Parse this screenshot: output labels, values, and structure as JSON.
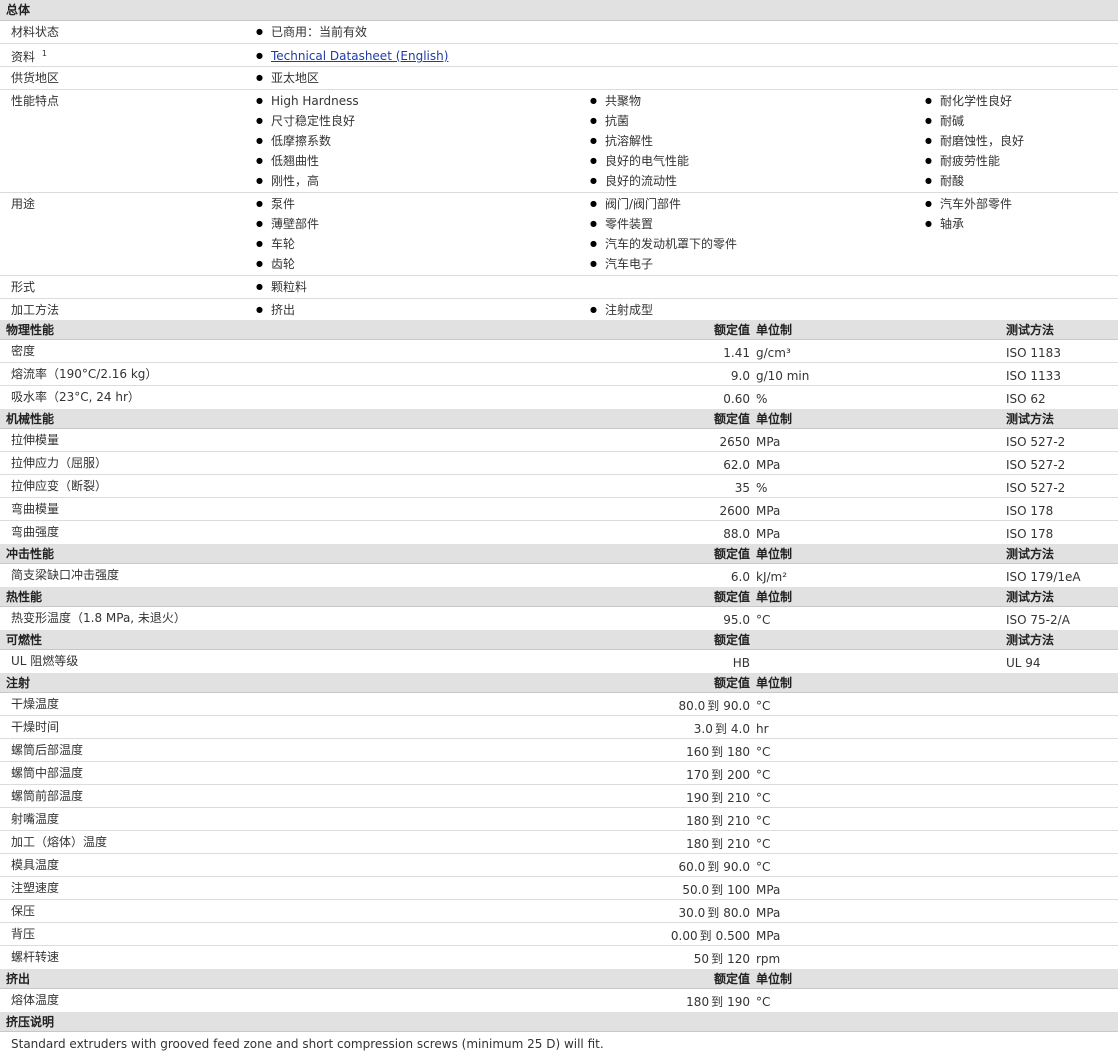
{
  "general": {
    "title": "总体",
    "status_label": "材料状态",
    "status_value": "已商用：当前有效",
    "docs_label": "资料",
    "docs_sup": "1",
    "docs_link": "Technical Datasheet (English)",
    "region_label": "供货地区",
    "region_value": "亚太地区",
    "features_label": "性能特点",
    "features": [
      [
        "High Hardness",
        "尺寸稳定性良好",
        "低摩擦系数",
        "低翘曲性",
        "刚性，高"
      ],
      [
        "共聚物",
        "抗菌",
        "抗溶解性",
        "良好的电气性能",
        "良好的流动性"
      ],
      [
        "耐化学性良好",
        "耐碱",
        "耐磨蚀性，良好",
        "耐疲劳性能",
        "耐酸"
      ]
    ],
    "uses_label": "用途",
    "uses": [
      [
        "泵件",
        "薄壁部件",
        "车轮",
        "齿轮"
      ],
      [
        "阀门/阀门部件",
        "零件装置",
        "汽车的发动机罩下的零件",
        "汽车电子"
      ],
      [
        "汽车外部零件",
        "轴承"
      ]
    ],
    "form_label": "形式",
    "form_value": "颗粒料",
    "process_label": "加工方法",
    "process_values": [
      "挤出",
      "注射成型"
    ]
  },
  "col_headers": {
    "nominal": "额定值",
    "unit": "单位制",
    "method": "测试方法"
  },
  "physical": {
    "title": "物理性能",
    "rows": [
      {
        "name": "密度",
        "value": "1.41",
        "unit": "g/cm³",
        "method": "ISO 1183"
      },
      {
        "name": "熔流率（190°C/2.16 kg）",
        "value": "9.0",
        "unit": "g/10 min",
        "method": "ISO 1133"
      },
      {
        "name": "吸水率（23°C, 24 hr）",
        "value": "0.60",
        "unit": "%",
        "method": "ISO 62"
      }
    ]
  },
  "mechanical": {
    "title": "机械性能",
    "rows": [
      {
        "name": "拉伸模量",
        "value": "2650",
        "unit": "MPa",
        "method": "ISO 527-2"
      },
      {
        "name": "拉伸应力（屈服）",
        "value": "62.0",
        "unit": "MPa",
        "method": "ISO 527-2"
      },
      {
        "name": "拉伸应变（断裂）",
        "value": "35",
        "unit": "%",
        "method": "ISO 527-2"
      },
      {
        "name": "弯曲模量",
        "value": "2600",
        "unit": "MPa",
        "method": "ISO 178"
      },
      {
        "name": "弯曲强度",
        "value": "88.0",
        "unit": "MPa",
        "method": "ISO 178"
      }
    ]
  },
  "impact": {
    "title": "冲击性能",
    "rows": [
      {
        "name": "简支梁缺口冲击强度",
        "value": "6.0",
        "unit": "kJ/m²",
        "method": "ISO 179/1eA"
      }
    ]
  },
  "thermal": {
    "title": "热性能",
    "rows": [
      {
        "name": "热变形温度（1.8 MPa, 未退火）",
        "value": "95.0",
        "unit": "°C",
        "method": "ISO 75-2/A"
      }
    ]
  },
  "flammability": {
    "title": "可燃性",
    "rows": [
      {
        "name": "UL 阻燃等级",
        "value": "HB",
        "unit": "",
        "method": "UL 94"
      }
    ]
  },
  "injection": {
    "title": "注射",
    "range_word": "到",
    "rows": [
      {
        "name": "干燥温度",
        "low": "80.0",
        "high": "90.0",
        "unit": "°C"
      },
      {
        "name": "干燥时间",
        "low": "3.0",
        "high": "4.0",
        "unit": "hr"
      },
      {
        "name": "螺筒后部温度",
        "low": "160",
        "high": "180",
        "unit": "°C"
      },
      {
        "name": "螺筒中部温度",
        "low": "170",
        "high": "200",
        "unit": "°C"
      },
      {
        "name": "螺筒前部温度",
        "low": "190",
        "high": "210",
        "unit": "°C"
      },
      {
        "name": "射嘴温度",
        "low": "180",
        "high": "210",
        "unit": "°C"
      },
      {
        "name": "加工（熔体）温度",
        "low": "180",
        "high": "210",
        "unit": "°C"
      },
      {
        "name": "模具温度",
        "low": "60.0",
        "high": "90.0",
        "unit": "°C"
      },
      {
        "name": "注塑速度",
        "low": "50.0",
        "high": "100",
        "unit": "MPa"
      },
      {
        "name": "保压",
        "low": "30.0",
        "high": "80.0",
        "unit": "MPa"
      },
      {
        "name": "背压",
        "low": "0.00",
        "high": "0.500",
        "unit": "MPa"
      },
      {
        "name": "螺杆转速",
        "low": "50",
        "high": "120",
        "unit": "rpm"
      }
    ]
  },
  "extrusion": {
    "title": "挤出",
    "rows": [
      {
        "name": "熔体温度",
        "low": "180",
        "high": "190",
        "unit": "°C"
      }
    ]
  },
  "extrusion_notes": {
    "title": "挤压说明",
    "text": "Standard extruders with grooved feed zone and short compression screws (minimum 25 D) will fit."
  }
}
